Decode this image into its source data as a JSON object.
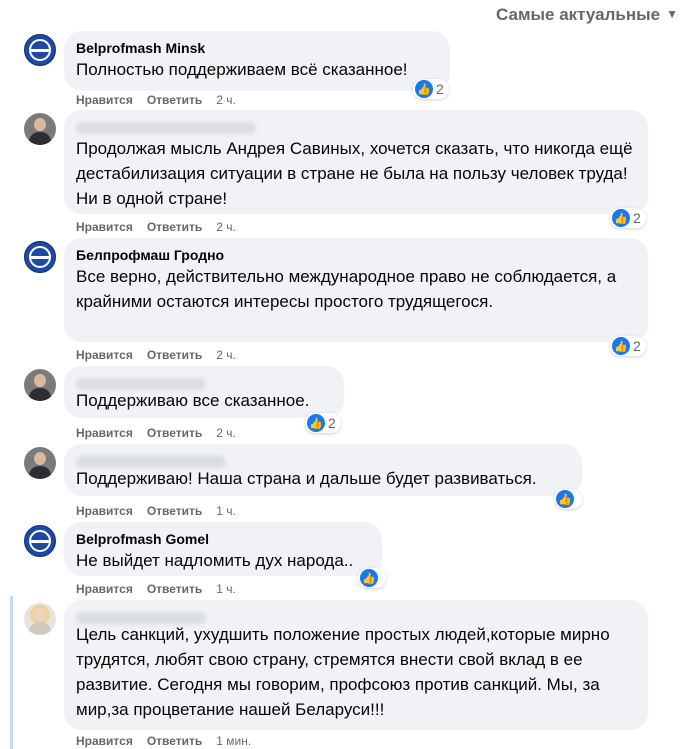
{
  "sort": {
    "label": "Самые актуальные",
    "chevron": "chevron-down-icon"
  },
  "comments": [
    {
      "author": "Belprofmash Minsk",
      "text": "Полностью поддерживаем всё сказанное!",
      "like": "Нравится",
      "reply": "Ответить",
      "time": "2 ч.",
      "reactions": "2"
    },
    {
      "author": "",
      "text": "Продолжая мысль Андрея Савиных, хочется сказать, что никогда ещё дестабилизация ситуации в стране не была на пользу человек труда! Ни в одной стране!",
      "like": "Нравится",
      "reply": "Ответить",
      "time": "2 ч.",
      "reactions": "2"
    },
    {
      "author": "Белпрофмаш Гродно",
      "text": "Все верно, действительно международное право не соблюдается, а крайними остаются интересы простого трудящегося.",
      "like": "Нравится",
      "reply": "Ответить",
      "time": "2 ч.",
      "reactions": "2"
    },
    {
      "author": "",
      "text": "Поддерживаю все сказанное.",
      "like": "Нравится",
      "reply": "Ответить",
      "time": "2 ч.",
      "reactions": "2"
    },
    {
      "author": "",
      "text": "Поддерживаю! Наша страна и дальше будет развиваться.",
      "like": "Нравится",
      "reply": "Ответить",
      "time": "1 ч.",
      "reactions": ""
    },
    {
      "author": "Belprofmash Gomel",
      "text": "Не выйдет надломить дух народа..",
      "like": "Нравится",
      "reply": "Ответить",
      "time": "1 ч.",
      "reactions": ""
    },
    {
      "author": "",
      "text": "Цель санкций, ухудшить положение простых людей,которые мирно трудятся, любят свою страну, стремятся внести свой вклад в ее развитие. Сегодня мы говорим, профсоюз против санкций. Мы, за мир,за процветание нашей Беларуси!!!",
      "like": "Нравится",
      "reply": "Ответить",
      "time": "1 мин.",
      "reactions": ""
    }
  ]
}
